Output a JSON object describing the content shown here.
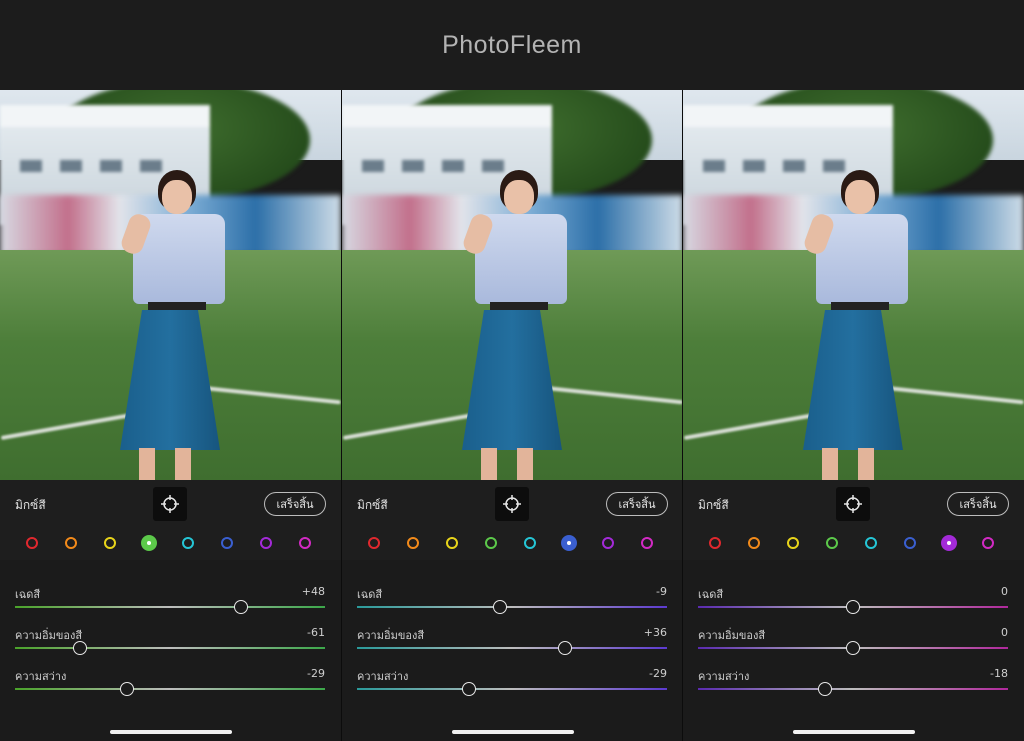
{
  "app": {
    "title": "PhotoFleem"
  },
  "panels": [
    {
      "mix_label": "มิกซ์สี",
      "done_label": "เสร็จสิ้น",
      "selected_index": 3,
      "sliders": [
        {
          "label": "เฉดสี",
          "value": "+48",
          "level": 0.73
        },
        {
          "label": "ความอิ่มของสี",
          "value": "-61",
          "level": 0.21
        },
        {
          "label": "ความสว่าง",
          "value": "-29",
          "level": 0.36
        }
      ]
    },
    {
      "mix_label": "มิกซ์สี",
      "done_label": "เสร็จสิ้น",
      "selected_index": 5,
      "sliders": [
        {
          "label": "เฉดสี",
          "value": "-9",
          "level": 0.46
        },
        {
          "label": "ความอิ่มของสี",
          "value": "+36",
          "level": 0.67
        },
        {
          "label": "ความสว่าง",
          "value": "-29",
          "level": 0.36
        }
      ]
    },
    {
      "mix_label": "มิกซ์สี",
      "done_label": "เสร็จสิ้น",
      "selected_index": 6,
      "sliders": [
        {
          "label": "เฉดสี",
          "value": "0",
          "level": 0.5
        },
        {
          "label": "ความอิ่มของสี",
          "value": "0",
          "level": 0.5
        },
        {
          "label": "ความสว่าง",
          "value": "-18",
          "level": 0.41
        }
      ]
    }
  ],
  "color_swatches": [
    "#e0282e",
    "#f28a1a",
    "#e8d41a",
    "#5cc94a",
    "#25c6d6",
    "#3a5fd0",
    "#a32ad8",
    "#d22ac4"
  ],
  "colors": {
    "background": "#1b1b1b",
    "title_bar": "#1c1c1c",
    "title_text": "#b3b3b3"
  },
  "icons": {
    "target": "crosshair-target-icon"
  }
}
